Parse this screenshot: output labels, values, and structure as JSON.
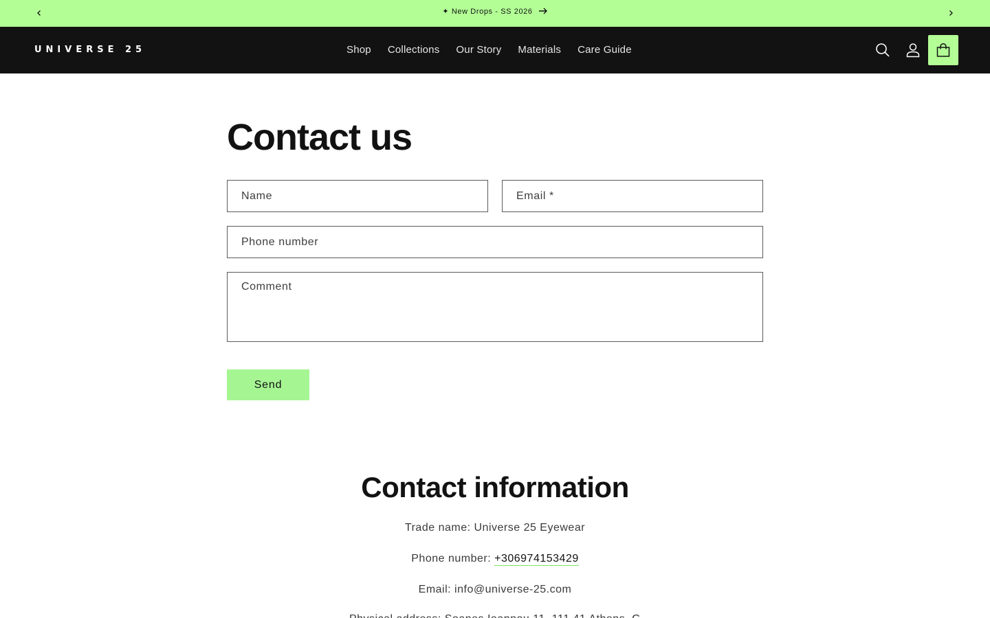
{
  "announcement": {
    "text": "✦ New Drops - SS 2026",
    "prev_icon": "chevron-left-icon",
    "next_icon": "chevron-right-icon",
    "arrow_icon": "arrow-right-icon"
  },
  "header": {
    "logo": "UNIVERSE 25",
    "nav": [
      "Shop",
      "Collections",
      "Our Story",
      "Materials",
      "Care Guide"
    ],
    "icons": [
      "search-icon",
      "account-icon",
      "cart-icon"
    ]
  },
  "contact_form": {
    "title": "Contact us",
    "name_placeholder": "Name",
    "email_placeholder": "Email *",
    "phone_placeholder": "Phone number",
    "comment_placeholder": "Comment",
    "send_label": "Send"
  },
  "contact_info": {
    "title": "Contact information",
    "trade_name": "Trade name: Universe 25 Eyewear",
    "phone_label": "Phone number: ",
    "phone_value": "+306974153429",
    "email": "Email: info@universe-25.com",
    "address_partial": "Physical address: Soanes Ioannou 11, 111 41 Athens, G"
  },
  "colors": {
    "accent": "#b3ff96",
    "header_bg": "#121212",
    "text": "#121212"
  }
}
